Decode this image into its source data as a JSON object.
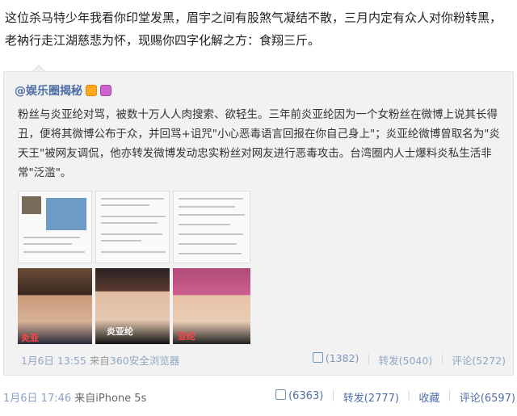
{
  "post": {
    "text": "这位杀马特少年我看你印堂发黑，眉宇之间有股煞气凝结不散，三月内定有众人对你粉转黑，老衲行走江湖慈悲为怀，现赐你四字化解之方：食翔三斤。",
    "time": "1月6日 17:46",
    "source_prefix": "来自",
    "source": "iPhone 5s",
    "like": "(6363)",
    "repost": "转发(2777)",
    "favorite": "收藏",
    "comment": "评论(6597)"
  },
  "repost": {
    "author": "@娱乐圈揭秘",
    "text": "粉丝与炎亚纶对骂，被数十万人人肉搜索、欲轻生。三年前炎亚纶因为一个女粉丝在微博上说其长得丑，便将其微博公布于众，并回骂+诅咒\"小心恶毒语言回报在你自己身上\"；炎亚纶微博曾取名为\"炎天王\"被网友调侃，他亦转发微博发动忠实粉丝对网友进行恶毒攻击。台湾圈内人士爆料炎私生活非常\"泛滥\"。",
    "time": "1月6日 13:55",
    "source_prefix": "来自",
    "source": "360安全浏览器",
    "like": "(1382)",
    "repost": "转发(5040)",
    "comment": "评论(5272)",
    "badge_icons": [
      "vip-icon",
      "member-icon"
    ]
  },
  "image_captions": [
    "炎亚",
    "炎亚纶",
    "亚纶"
  ],
  "colors": {
    "link": "#4e6ea6",
    "meta": "#8fa6c6",
    "panel": "#f2f2f2"
  }
}
